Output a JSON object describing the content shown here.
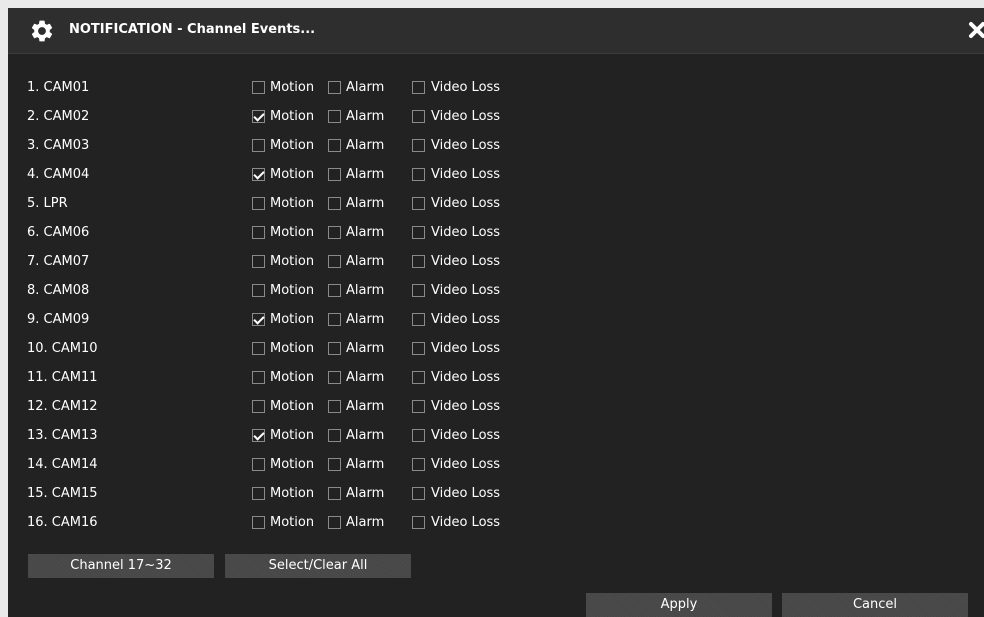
{
  "dialog": {
    "title": "NOTIFICATION - Channel Events...",
    "gear_icon": "gear-icon",
    "close_icon": "close-icon"
  },
  "labels": {
    "motion": "Motion",
    "alarm": "Alarm",
    "video_loss": "Video Loss"
  },
  "channels": [
    {
      "label": "1.  CAM01",
      "motion": false,
      "alarm": false,
      "video_loss": false
    },
    {
      "label": "2.  CAM02",
      "motion": true,
      "alarm": false,
      "video_loss": false
    },
    {
      "label": "3.  CAM03",
      "motion": false,
      "alarm": false,
      "video_loss": false
    },
    {
      "label": "4.  CAM04",
      "motion": true,
      "alarm": false,
      "video_loss": false
    },
    {
      "label": "5.  LPR",
      "motion": false,
      "alarm": false,
      "video_loss": false
    },
    {
      "label": "6.  CAM06",
      "motion": false,
      "alarm": false,
      "video_loss": false
    },
    {
      "label": "7.  CAM07",
      "motion": false,
      "alarm": false,
      "video_loss": false
    },
    {
      "label": "8.  CAM08",
      "motion": false,
      "alarm": false,
      "video_loss": false
    },
    {
      "label": "9.  CAM09",
      "motion": true,
      "alarm": false,
      "video_loss": false
    },
    {
      "label": "10. CAM10",
      "motion": false,
      "alarm": false,
      "video_loss": false
    },
    {
      "label": "11. CAM11",
      "motion": false,
      "alarm": false,
      "video_loss": false
    },
    {
      "label": "12. CAM12",
      "motion": false,
      "alarm": false,
      "video_loss": false
    },
    {
      "label": "13. CAM13",
      "motion": true,
      "alarm": false,
      "video_loss": false
    },
    {
      "label": "14. CAM14",
      "motion": false,
      "alarm": false,
      "video_loss": false
    },
    {
      "label": "15. CAM15",
      "motion": false,
      "alarm": false,
      "video_loss": false
    },
    {
      "label": "16. CAM16",
      "motion": false,
      "alarm": false,
      "video_loss": false
    }
  ],
  "buttons": {
    "channel_range": "Channel 17~32",
    "select_clear_all": "Select/Clear All",
    "apply": "Apply",
    "cancel": "Cancel"
  },
  "colors": {
    "background": "#222222",
    "titlebar": "#2e2e2e",
    "text": "#ffffff",
    "button": "#4a4a4a"
  }
}
